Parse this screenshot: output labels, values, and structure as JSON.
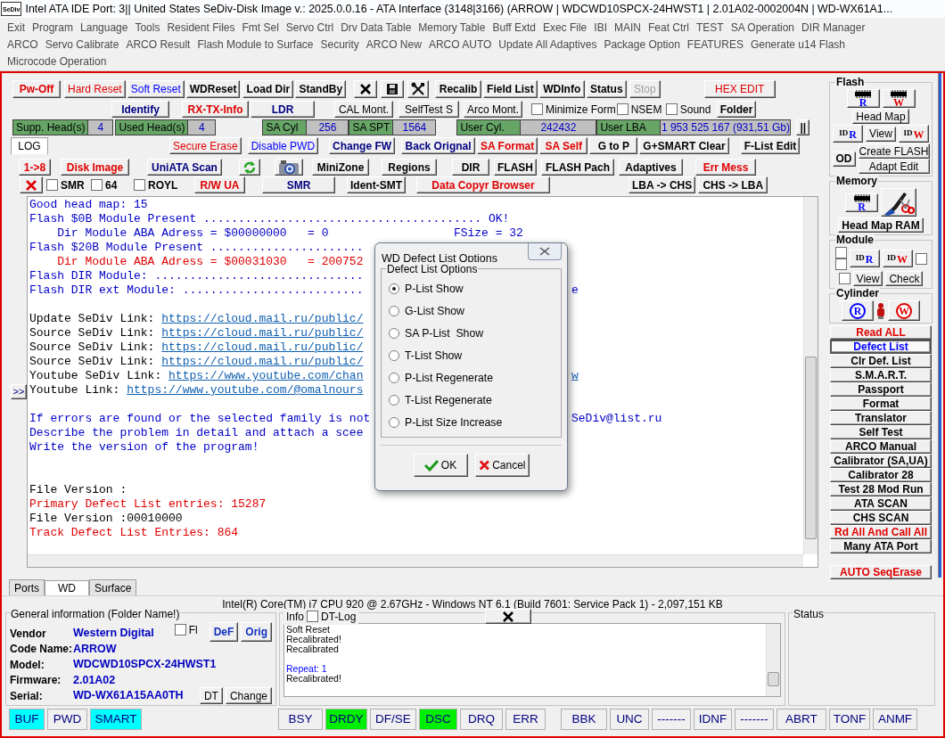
{
  "window": {
    "logo": "SeDiv",
    "title": "Intel ATA IDE  Port: 3|| United States  SeDiv-Disk Image v.: 2025.0.0.16 - ATA Interface (3148|3166)  (ARROW | WDCWD10SPCX-24HWST1 | 2.01A02-0002004N | WD-WX61A1..."
  },
  "menu": [
    [
      "Exit",
      "Program",
      "Language",
      "Tools",
      "Resident Files",
      "Fmt Sel",
      "Servo Ctrl",
      "Drv Data Table",
      "Memory Table",
      "Buff Extd",
      "Exec File",
      "IBI",
      "MAIN",
      "Feat Ctrl",
      "TEST",
      "SA Operation",
      "DIR Manager"
    ],
    [
      "ARCO",
      "Servo Calibrate",
      "ARCO Result",
      "Flash Module to Surface",
      "Security",
      "ARCO New",
      "ARCO AUTO",
      "Update All Adaptives",
      "Package Option",
      "FEATURES",
      "Generate u14 Flash"
    ],
    [
      "Microcode Operation"
    ]
  ],
  "toolbar_rows": [
    [
      {
        "kind": "button",
        "label": "Pw-Off",
        "color": "#e00000",
        "bold": true
      },
      {
        "kind": "button",
        "label": "Hard Reset",
        "color": "#e00000",
        "bold": false
      },
      {
        "kind": "button",
        "label": "Soft Reset",
        "color": "#0000ff",
        "bold": false
      },
      {
        "kind": "button",
        "label": "WDReset",
        "color": "#000000",
        "bold": true
      },
      {
        "kind": "button",
        "label": "Load Dir",
        "color": "#000000",
        "bold": true
      },
      {
        "kind": "button",
        "label": "StandBy",
        "color": "#000000",
        "bold": true
      },
      {
        "kind": "close"
      },
      {
        "kind": "save"
      },
      {
        "kind": "tools"
      },
      {
        "kind": "button",
        "label": "Recalib",
        "color": "#000000",
        "bold": true
      },
      {
        "kind": "button",
        "label": "Field List",
        "color": "#000000",
        "bold": true
      },
      {
        "kind": "button",
        "label": "WDInfo",
        "color": "#000000",
        "bold": true
      },
      {
        "kind": "button",
        "label": "Status",
        "color": "#000000",
        "bold": true
      },
      {
        "kind": "button",
        "label": "Stop",
        "color": "#a0a0a0",
        "bold": false
      },
      {
        "kind": "button",
        "label": "HEX EDIT",
        "color": "#e00000",
        "bold": false
      }
    ],
    [
      {
        "kind": "button",
        "label": "Identify",
        "color": "#000080",
        "bold": true
      },
      {
        "kind": "button",
        "label": "RX-TX-Info",
        "color": "#e00000",
        "bold": true
      },
      {
        "kind": "button",
        "label": "LDR",
        "color": "#000080",
        "bold": true
      },
      {
        "kind": "button",
        "label": "CAL Mont.",
        "color": "#000000",
        "bold": false
      },
      {
        "kind": "button",
        "label": "SelfTest S",
        "color": "#000000",
        "bold": false
      },
      {
        "kind": "button",
        "label": "Arco Mont.",
        "color": "#000000",
        "bold": false
      },
      {
        "kind": "checkbox",
        "label": "Minimize Form",
        "checked": false,
        "bold": false
      },
      {
        "kind": "checkbox",
        "label": "NSEM",
        "checked": false,
        "bold": false
      },
      {
        "kind": "checkbox",
        "label": "Sound",
        "checked": false,
        "bold": false
      },
      {
        "kind": "button",
        "label": "Folder",
        "color": "#000000",
        "bold": true
      }
    ],
    [
      {
        "kind": "field",
        "label": "Supp. Head(s)",
        "value": "4"
      },
      {
        "kind": "field",
        "label": "Used Head(s)",
        "value": "4"
      },
      {
        "kind": "field",
        "label": "SA Cyl",
        "value": "256"
      },
      {
        "kind": "field",
        "label": "SA SPT",
        "value": "1564"
      },
      {
        "kind": "field",
        "label": "User Cyl.",
        "value": "242432"
      },
      {
        "kind": "field",
        "label": "User LBA",
        "value": "1 953 525 167  (931,51 Gb)"
      },
      {
        "kind": "button",
        "label": "||",
        "color": "#000000",
        "bold": true
      }
    ],
    [
      {
        "kind": "tab",
        "label": "LOG",
        "selected": true
      },
      {
        "kind": "button",
        "label": "Secure Erase",
        "color": "#e00000",
        "bold": false
      },
      {
        "kind": "button",
        "label": "Disable PWD",
        "color": "#0000ff",
        "bold": false
      },
      {
        "kind": "button",
        "label": "Change FW",
        "color": "#000080",
        "bold": true
      },
      {
        "kind": "button",
        "label": "Back Orignal",
        "color": "#000080",
        "bold": true
      },
      {
        "kind": "button",
        "label": "SA Format",
        "color": "#e00000",
        "bold": true
      },
      {
        "kind": "button",
        "label": "SA Self",
        "color": "#e00000",
        "bold": true
      },
      {
        "kind": "button",
        "label": "G to P",
        "color": "#000000",
        "bold": true
      },
      {
        "kind": "button",
        "label": "G+SMART Clear",
        "color": "#000000",
        "bold": true
      },
      {
        "kind": "button",
        "label": "F-List Edit",
        "color": "#000000",
        "bold": true
      }
    ],
    [
      {
        "kind": "button",
        "label": "1->8",
        "color": "#e00000",
        "bold": true
      },
      {
        "kind": "button",
        "label": "Disk Image",
        "color": "#e00000",
        "bold": true
      },
      {
        "kind": "button",
        "label": "UniATA Scan",
        "color": "#000080",
        "bold": true
      },
      {
        "kind": "refresh"
      },
      {
        "kind": "camera"
      },
      {
        "kind": "button",
        "label": "MiniZone",
        "color": "#000000",
        "bold": true
      },
      {
        "kind": "button",
        "label": "Regions",
        "color": "#000000",
        "bold": true
      },
      {
        "kind": "button",
        "label": "DIR",
        "color": "#000000",
        "bold": true
      },
      {
        "kind": "button",
        "label": "FLASH",
        "color": "#000000",
        "bold": true
      },
      {
        "kind": "button",
        "label": "FLASH Pach",
        "color": "#000000",
        "bold": true
      },
      {
        "kind": "button",
        "label": "Adaptives",
        "color": "#000000",
        "bold": true
      },
      {
        "kind": "button",
        "label": "Err Mess",
        "color": "#e00000",
        "bold": true
      }
    ],
    [
      {
        "kind": "delete"
      },
      {
        "kind": "checkbox",
        "label": "SMR",
        "checked": false,
        "bold": true
      },
      {
        "kind": "checkbox",
        "label": "64",
        "checked": false,
        "bold": true
      },
      {
        "kind": "checkbox",
        "label": "ROYL",
        "checked": false,
        "bold": true
      },
      {
        "kind": "button",
        "label": "R/W UA",
        "color": "#e00000",
        "bold": true
      },
      {
        "kind": "button",
        "label": "SMR",
        "color": "#000080",
        "bold": true
      },
      {
        "kind": "button",
        "label": "Ident-SMT",
        "color": "#000000",
        "bold": true
      },
      {
        "kind": "button",
        "label": "Data Copyr Browser",
        "color": "#e00000",
        "bold": true
      },
      {
        "kind": "button",
        "label": "LBA -> CHS",
        "color": "#000000",
        "bold": true
      },
      {
        "kind": "button",
        "label": "CHS -> LBA",
        "color": "#000000",
        "bold": true
      }
    ]
  ],
  "side_toggle": ">>",
  "log": {
    "lines": [
      {
        "kind": "text",
        "text": "Good head map: 15",
        "color": "#0000c8"
      },
      {
        "kind": "text",
        "text": "Flash $0B Module Present ........................................ OK!",
        "color": "#0000c8"
      },
      {
        "kind": "text",
        "text": "    Dir Module ABA Adress = $00000000   = 0                  FSize = 32",
        "color": "#0000c8"
      },
      {
        "kind": "text",
        "text": "Flash $20B Module Present ......................",
        "color": "#0000c8"
      },
      {
        "kind": "text",
        "text": "    Dir Module ABA Adress = $00031030   = 200752",
        "color": "#e00000"
      },
      {
        "kind": "text",
        "text": "Flash DIR Module: ..............................",
        "color": "#0000c8"
      },
      {
        "kind": "text",
        "text": "Flash DIR ext Module: ..........................",
        "color": "#0000c8",
        "tail": "e"
      },
      {
        "kind": "blank"
      },
      {
        "kind": "link",
        "text": "Update SeDiv Link: ",
        "color": "#000000",
        "link": "https://cloud.mail.ru/public/"
      },
      {
        "kind": "link",
        "text": "Source SeDiv Link: ",
        "color": "#000000",
        "link": "https://cloud.mail.ru/public/"
      },
      {
        "kind": "link",
        "text": "Source SeDiv Link: ",
        "color": "#000000",
        "link": "https://cloud.mail.ru/public/"
      },
      {
        "kind": "link",
        "text": "Source SeDiv Link: ",
        "color": "#000000",
        "link": "https://cloud.mail.ru/public/"
      },
      {
        "kind": "link",
        "text": "Youtube SeDiv Link: ",
        "color": "#000000",
        "link": "https://www.youtube.com/chan",
        "tail": "w"
      },
      {
        "kind": "link",
        "text": "Youtube Link: ",
        "color": "#000000",
        "link": "https://www.youtube.com/@omalnours"
      },
      {
        "kind": "blank"
      },
      {
        "kind": "text",
        "text": "If errors are found or the selected family is not",
        "color": "#0000c8",
        "tail": "SeDiv@list.ru"
      },
      {
        "kind": "text",
        "text": "Describe the problem in detail and attach a scee",
        "color": "#0000c8"
      },
      {
        "kind": "text",
        "text": "Write the version of the program!",
        "color": "#0000c8"
      },
      {
        "kind": "blank"
      },
      {
        "kind": "blank"
      },
      {
        "kind": "text",
        "text": "File Version :",
        "color": "#000000"
      },
      {
        "kind": "text",
        "text": "Primary Defect List entries: 15287",
        "color": "#e00000"
      },
      {
        "kind": "text",
        "text": "File Version :00010000",
        "color": "#000000"
      },
      {
        "kind": "text",
        "text": "Track Defect List Entries: 864",
        "color": "#e00000"
      }
    ]
  },
  "dialog": {
    "title": "WD Defect List Options",
    "group": "Defect List Options",
    "options": [
      {
        "label": "P-List Show",
        "selected": true
      },
      {
        "label": "G-List Show",
        "selected": false
      },
      {
        "label": "SA P-List  Show",
        "selected": false
      },
      {
        "label": "T-List Show",
        "selected": false
      },
      {
        "label": "P-List Regenerate",
        "selected": false
      },
      {
        "label": "T-List Regenerate",
        "selected": false
      },
      {
        "label": "P-List Size Increase",
        "selected": false
      }
    ],
    "buttons": [
      {
        "kind": "ok",
        "label": "OK"
      },
      {
        "kind": "cancel",
        "label": "Cancel"
      }
    ]
  },
  "side_panel": {
    "groups": [
      {
        "title": "Flash",
        "rows": [
          [
            {
              "kind": "chip",
              "letter": "R",
              "color": "#0000ff"
            },
            {
              "kind": "chip",
              "letter": "W",
              "color": "#e00000"
            }
          ],
          [
            {
              "kind": "button",
              "label": "Head Map",
              "bold": false
            }
          ],
          [
            {
              "kind": "id",
              "tag": "ID",
              "letter": "R",
              "color": "#0000ff"
            },
            {
              "kind": "button",
              "label": "View",
              "bold": false
            },
            {
              "kind": "id",
              "tag": "ID",
              "letter": "W",
              "color": "#e00000"
            }
          ],
          [
            {
              "kind": "button",
              "label": "OD",
              "bold": true
            },
            {
              "kind": "stack",
              "items": [
                {
                  "kind": "button",
                  "label": "Create FLASH",
                  "bold": false
                },
                {
                  "kind": "button",
                  "label": "Adapt Edit",
                  "bold": false
                }
              ]
            }
          ]
        ]
      },
      {
        "title": "Memory",
        "rows": [
          [
            {
              "kind": "chip",
              "letter": "R",
              "color": "#0000ff"
            },
            {
              "kind": "scissors"
            }
          ],
          [
            {
              "kind": "button",
              "label": "Head Map RAM",
              "bold": true
            }
          ]
        ]
      },
      {
        "title": "Module",
        "rows": [
          [
            {
              "kind": "stack",
              "items": [
                {
                  "kind": "checkbox",
                  "checked": false
                },
                {
                  "kind": "checkbox",
                  "checked": false
                }
              ]
            },
            {
              "kind": "id",
              "tag": "ID",
              "letter": "R",
              "color": "#0000ff"
            },
            {
              "kind": "id",
              "tag": "ID",
              "letter": "W",
              "color": "#e00000"
            },
            {
              "kind": "checkbox",
              "checked": false
            }
          ],
          [
            {
              "kind": "checkbox",
              "checked": false
            },
            {
              "kind": "button",
              "label": "View",
              "bold": false
            },
            {
              "kind": "button",
              "label": "Check",
              "bold": false
            }
          ]
        ]
      },
      {
        "title": "Cylinder",
        "rows": [
          [
            {
              "kind": "circle",
              "letter": "R",
              "color": "#0000ff"
            },
            {
              "kind": "figure"
            },
            {
              "kind": "circle",
              "letter": "W",
              "color": "#e00000"
            }
          ]
        ]
      }
    ],
    "buttons": [
      {
        "label": "Read ALL",
        "color": "#e00000",
        "selected": false
      },
      {
        "label": "Defect List",
        "color": "#0000ff",
        "selected": true
      },
      {
        "label": "Clr Def. List",
        "color": "#000000",
        "selected": false
      },
      {
        "label": "S.M.A.R.T.",
        "color": "#000000",
        "selected": false
      },
      {
        "label": "Passport",
        "color": "#000000",
        "selected": false
      },
      {
        "label": "Format",
        "color": "#000000",
        "selected": false
      },
      {
        "label": "Translator",
        "color": "#000000",
        "selected": false
      },
      {
        "label": "Self Test",
        "color": "#000000",
        "selected": false
      },
      {
        "label": "ARCO Manual",
        "color": "#000000",
        "selected": false
      },
      {
        "label": "Calibrator (SA,UA)",
        "color": "#000000",
        "selected": false
      },
      {
        "label": "Calibrator 28",
        "color": "#000000",
        "selected": false
      },
      {
        "label": "Test 28 Mod Run",
        "color": "#000000",
        "selected": false
      },
      {
        "label": "ATA SCAN",
        "color": "#000000",
        "selected": false
      },
      {
        "label": "CHS SCAN",
        "color": "#000000",
        "selected": false
      },
      {
        "label": "Rd All And Call All",
        "color": "#e00000",
        "selected": false
      },
      {
        "label": "Many ATA Port",
        "color": "#000000",
        "selected": false
      }
    ],
    "bottom_button": {
      "label": "AUTO SeqErase",
      "color": "#e00000"
    }
  },
  "bottom_tabs": [
    {
      "label": "Ports",
      "selected": false
    },
    {
      "label": "WD",
      "selected": true
    },
    {
      "label": "Surface",
      "selected": false
    }
  ],
  "system_info": "Intel(R) Core(TM) i7 CPU 920  @ 2.67GHz - Windows NT 6.1 (Build 7601: Service Pack 1) -  2,097,151 KB",
  "general_info": {
    "title": "General information (Folder Name!)",
    "checkbox": {
      "label": "Fl",
      "checked": false
    },
    "top_buttons": [
      "DeF",
      "Orig"
    ],
    "fields": [
      {
        "label": "Vendor",
        "value": "Western Digital"
      },
      {
        "label": "Code Name:",
        "value": "ARROW"
      },
      {
        "label": "Model:",
        "value": "WDCWD10SPCX-24HWST1"
      },
      {
        "label": "Firmware:",
        "value": "2.01A02"
      },
      {
        "label": "Serial:",
        "value": "WD-WX61A15AA0TH"
      }
    ],
    "bottom_buttons": [
      "DT",
      "Change"
    ]
  },
  "info_panel": {
    "title": "Info",
    "checkbox": {
      "label": "DT-Log",
      "checked": false
    },
    "lines": [
      {
        "kind": "text",
        "text": "Soft Reset",
        "color": "#000000"
      },
      {
        "kind": "text",
        "text": "Recalibrated!",
        "color": "#000000"
      },
      {
        "kind": "text",
        "text": "Recalibrated",
        "color": "#000000"
      },
      {
        "kind": "blank"
      },
      {
        "kind": "text",
        "text": "Repeat: 1",
        "color": "#0000ff"
      },
      {
        "kind": "text",
        "text": "Recalibrated!",
        "color": "#000000"
      }
    ]
  },
  "status_panel": {
    "title": "Status"
  },
  "flags": [
    [
      {
        "label": "BUF",
        "on": true,
        "color": "#00ffff"
      },
      {
        "label": "PWD",
        "on": false
      },
      {
        "label": "SMART",
        "on": true,
        "color": "#00ffff"
      }
    ],
    [
      {
        "label": "BSY",
        "on": false
      },
      {
        "label": "DRDY",
        "on": true,
        "color": "#00ee00"
      },
      {
        "label": "DF/SE",
        "on": false
      },
      {
        "label": "DSC",
        "on": true,
        "color": "#00ee00"
      },
      {
        "label": "DRQ",
        "on": false
      },
      {
        "label": "ERR",
        "on": false
      }
    ],
    [
      {
        "label": "BBK",
        "on": false
      },
      {
        "label": "UNC",
        "on": false
      },
      {
        "label": "-------",
        "on": false
      },
      {
        "label": "IDNF",
        "on": false
      },
      {
        "label": "-------",
        "on": false
      },
      {
        "label": "ABRT",
        "on": false
      },
      {
        "label": "TONF",
        "on": false
      },
      {
        "label": "ANMF",
        "on": false
      }
    ]
  ]
}
